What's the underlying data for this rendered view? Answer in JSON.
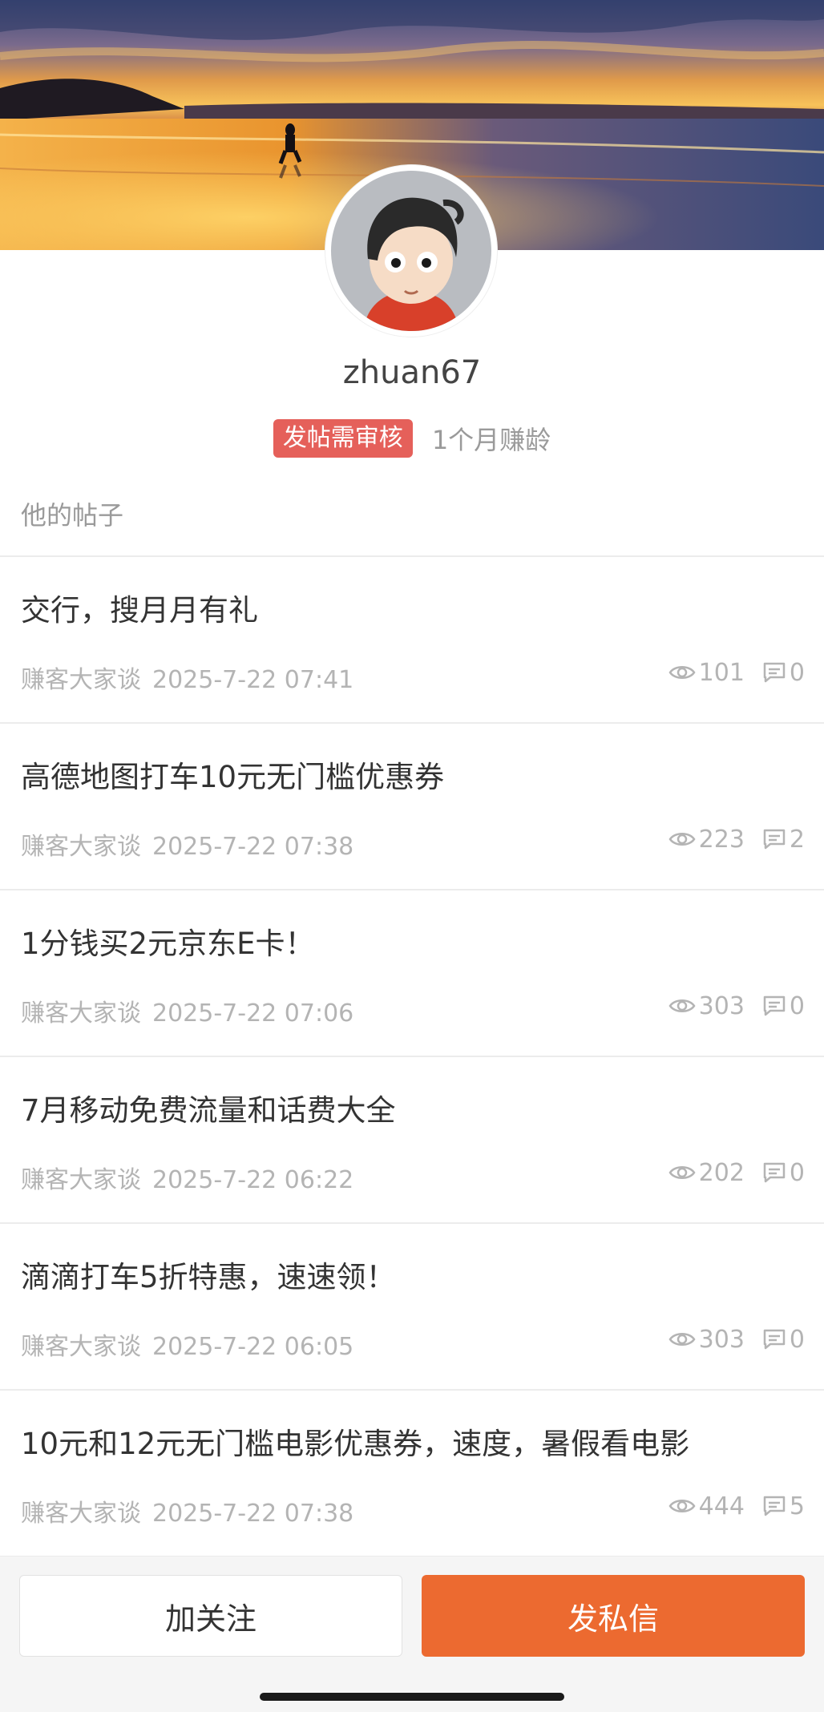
{
  "profile": {
    "username": "zhuan67",
    "badge": "发帖需审核",
    "age": "1个月赚龄"
  },
  "section_title": "他的帖子",
  "posts": [
    {
      "title": "交行，搜月月有礼",
      "category": "赚客大家谈",
      "date": "2025-7-22 07:41",
      "views": "101",
      "comments": "0"
    },
    {
      "title": "高德地图打车10元无门槛优惠券",
      "category": "赚客大家谈",
      "date": "2025-7-22 07:38",
      "views": "223",
      "comments": "2"
    },
    {
      "title": "1分钱买2元京东E卡！",
      "category": "赚客大家谈",
      "date": "2025-7-22 07:06",
      "views": "303",
      "comments": "0"
    },
    {
      "title": "7月移动免费流量和话费大全",
      "category": "赚客大家谈",
      "date": "2025-7-22 06:22",
      "views": "202",
      "comments": "0"
    },
    {
      "title": "滴滴打车5折特惠，速速领！",
      "category": "赚客大家谈",
      "date": "2025-7-22 06:05",
      "views": "303",
      "comments": "0"
    },
    {
      "title": "10元和12元无门槛电影优惠券，速度，暑假看电影",
      "category": "赚客大家谈",
      "date": "2025-7-22 07:38",
      "views": "444",
      "comments": "5"
    }
  ],
  "actions": {
    "follow_label": "加关注",
    "message_label": "发私信"
  },
  "colors": {
    "badge": "#e5605a",
    "primary_button": "#ec6a30"
  },
  "icons": {
    "views": "eye-icon",
    "comments": "comment-icon"
  }
}
